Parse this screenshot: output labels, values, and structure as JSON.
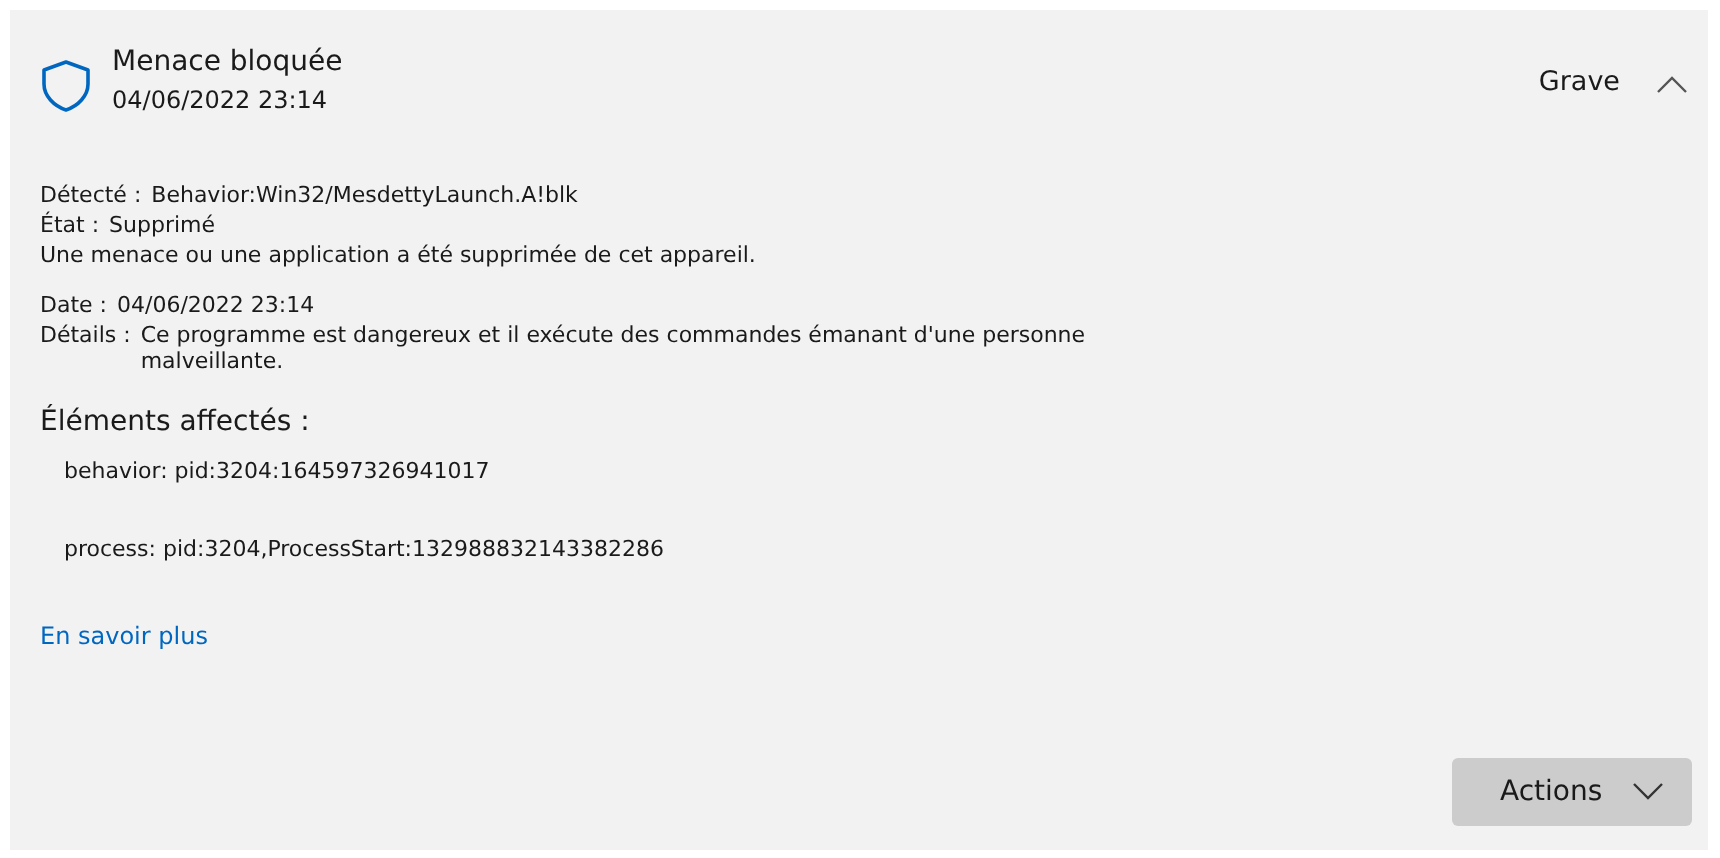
{
  "threat": {
    "title": "Menace bloquée",
    "timestamp": "04/06/2022 23:14",
    "severity": "Grave",
    "expanded": true
  },
  "fields": [
    {
      "label": "Détecté :",
      "value": "Behavior:Win32/MesdettyLaunch.A!blk"
    },
    {
      "label": "État :",
      "value": "Supprimé"
    }
  ],
  "status_message": "Une menace ou une application a été supprimée de cet appareil.",
  "details": [
    {
      "label": "Date :",
      "value": "04/06/2022 23:14"
    },
    {
      "label": "Détails :",
      "value": "Ce programme est dangereux et il exécute des commandes émanant d'une personne malveillante."
    }
  ],
  "affected": {
    "heading": "Éléments affectés :",
    "items": [
      "behavior: pid:3204:164597326941017",
      "process: pid:3204,ProcessStart:132988832143382286"
    ]
  },
  "learn_more": "En savoir plus",
  "actions_button": "Actions"
}
